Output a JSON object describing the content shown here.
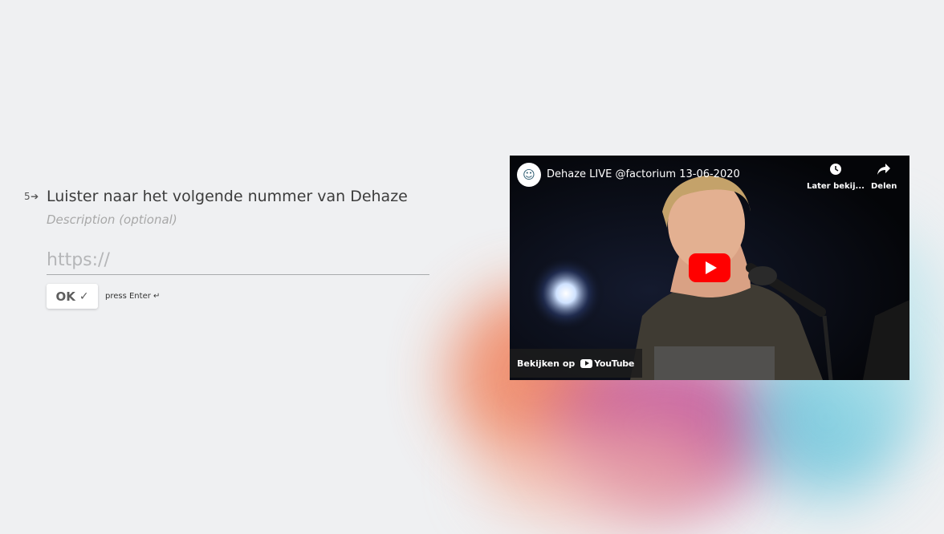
{
  "question": {
    "number": "5",
    "arrow": "➔",
    "title": "Luister naar het volgende nummer van Dehaze",
    "description": "Description (optional)",
    "input_placeholder": "https://",
    "input_value": "",
    "ok_label": "OK",
    "ok_check": "✓",
    "hint": "press Enter ↵"
  },
  "video": {
    "title": "Dehaze LIVE @factorium 13-06-2020",
    "watch_later_label": "Later bekij...",
    "share_label": "Delen",
    "watch_on_label": "Bekijken op",
    "youtube_label": "YouTube",
    "play_icon": "play-icon",
    "clock_icon": "clock-icon",
    "share_icon": "share-arrow-icon"
  },
  "colors": {
    "background": "#eff0f2",
    "play_button": "#ff0000",
    "text_primary": "#3c3c3c",
    "text_muted": "#a8a8a8"
  }
}
